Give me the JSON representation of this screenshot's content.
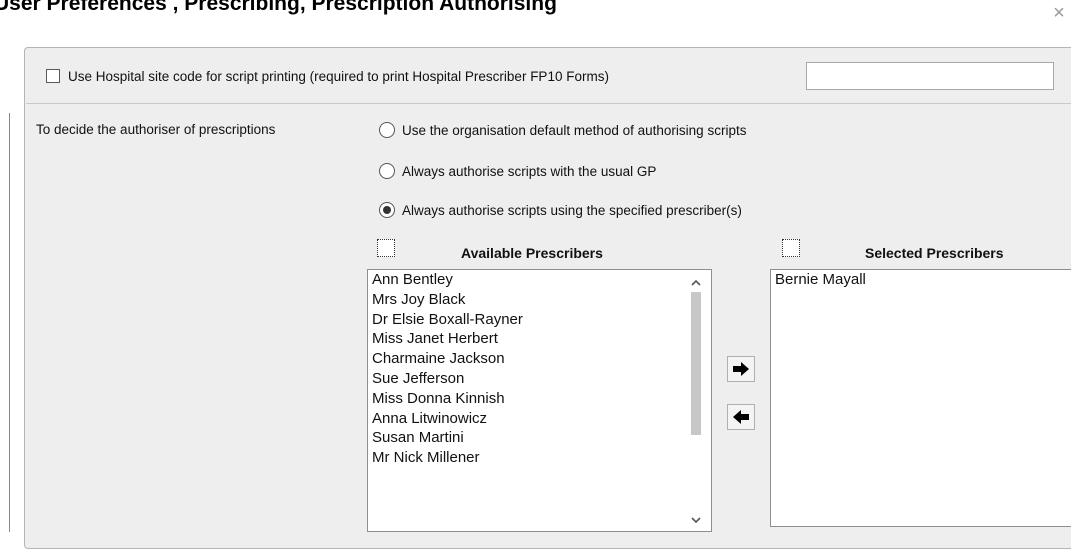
{
  "dialog": {
    "title": "User Preferences , Prescribing, Prescription Authorising",
    "close_symbol": "×"
  },
  "hospital_site": {
    "checkbox_label": "Use Hospital site code for script printing (required to print Hospital Prescriber FP10 Forms)",
    "checked": false,
    "value": ""
  },
  "authoriser": {
    "label": "To decide the authoriser of prescriptions",
    "options": [
      {
        "label": "Use the organisation default method of authorising scripts",
        "selected": false
      },
      {
        "label": "Always authorise scripts with the usual GP",
        "selected": false
      },
      {
        "label": "Always authorise scripts using the specified prescriber(s)",
        "selected": true
      }
    ]
  },
  "available": {
    "header": "Available Prescribers",
    "items": [
      "Ann Bentley",
      "Mrs Joy Black",
      "Dr Elsie Boxall-Rayner",
      "Miss Janet Herbert",
      "Charmaine Jackson",
      "Sue Jefferson",
      "Miss Donna Kinnish",
      "Anna Litwinowicz",
      "Susan Martini",
      "Mr Nick Millener"
    ]
  },
  "selected": {
    "header": "Selected Prescribers",
    "items": [
      "Bernie Mayall"
    ]
  },
  "icons": {
    "move_right": "arrow-right-icon",
    "move_left": "arrow-left-icon",
    "scroll_up": "chevron-up-icon",
    "scroll_down": "chevron-down-icon",
    "close": "close-icon"
  }
}
